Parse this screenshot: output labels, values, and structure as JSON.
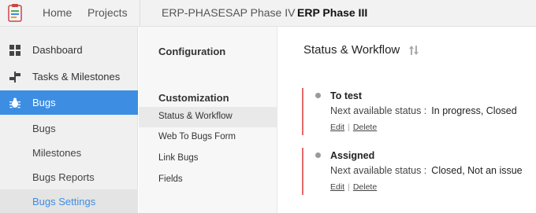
{
  "topnav": {
    "home": "Home",
    "projects": "Projects"
  },
  "project_tabs": [
    "ERP-PHASE",
    "SAP Phase IV",
    "ERP Phase III"
  ],
  "sidebar": {
    "items": [
      {
        "label": "Dashboard",
        "icon": "grid-icon"
      },
      {
        "label": "Tasks & Milestones",
        "icon": "signpost-icon"
      },
      {
        "label": "Bugs",
        "icon": "bug-icon",
        "active": true
      }
    ],
    "sub_items": [
      {
        "label": "Bugs"
      },
      {
        "label": "Milestones"
      },
      {
        "label": "Bugs Reports"
      },
      {
        "label": "Bugs Settings",
        "selected": true
      }
    ]
  },
  "settings": {
    "configuration_heading": "Configuration",
    "customization_heading": "Customization",
    "items": [
      "Status & Workflow",
      "Web To Bugs Form",
      "Link Bugs",
      "Fields"
    ]
  },
  "content": {
    "title": "Status & Workflow",
    "statuses": [
      {
        "name": "To test",
        "next_label": "Next available status :",
        "next_value": "In progress, Closed",
        "edit": "Edit",
        "delete": "Delete"
      },
      {
        "name": "Assigned",
        "next_label": "Next available status :",
        "next_value": "Closed, Not an issue",
        "edit": "Edit",
        "delete": "Delete"
      }
    ]
  },
  "colors": {
    "accent": "#3d8ee2",
    "status_bar": "#e36a6a"
  }
}
